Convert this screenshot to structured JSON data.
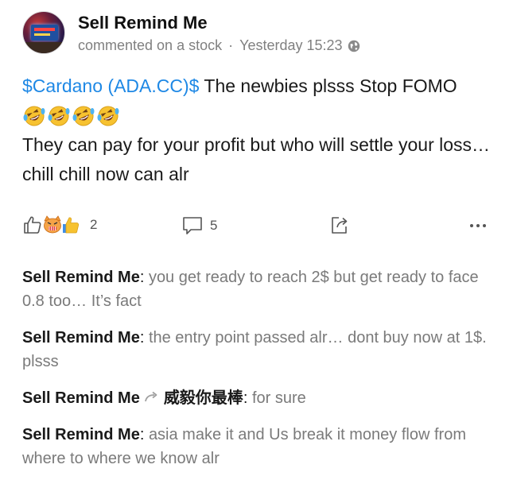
{
  "post": {
    "author": "Sell Remind Me",
    "action": "commented on a stock",
    "separator": "·",
    "time": "Yesterday 15:23",
    "ticker": "$Cardano (ADA.CC)$",
    "text_line1": " The newbies plsss Stop FOMO",
    "text_line2": "They can pay for your profit but who will settle your loss… chill chill now can alr",
    "emoji_icons": [
      "rofl-emoji-icon",
      "rofl-emoji-icon",
      "rofl-emoji-icon",
      "rofl-emoji-icon"
    ]
  },
  "actions": {
    "likes": "2",
    "comments": "5"
  },
  "comments": [
    {
      "author": "Sell Remind Me",
      "sep": ": ",
      "text": "you get ready to reach 2$ but get ready to face 0.8 too… It’s fact"
    },
    {
      "author": "Sell Remind Me",
      "sep": ": ",
      "text": "the entry point passed alr… dont buy now at 1$. plsss"
    },
    {
      "author": "Sell Remind Me",
      "reply_to": "威毅你最棒",
      "sep": ": ",
      "text": "for sure"
    },
    {
      "author": "Sell Remind Me",
      "sep": ": ",
      "text": "asia make it and Us break it money flow from where to where we know alr"
    }
  ],
  "colors": {
    "ticker": "#1e88e5",
    "meta": "#808080",
    "comment_text": "#7a7a7a"
  }
}
